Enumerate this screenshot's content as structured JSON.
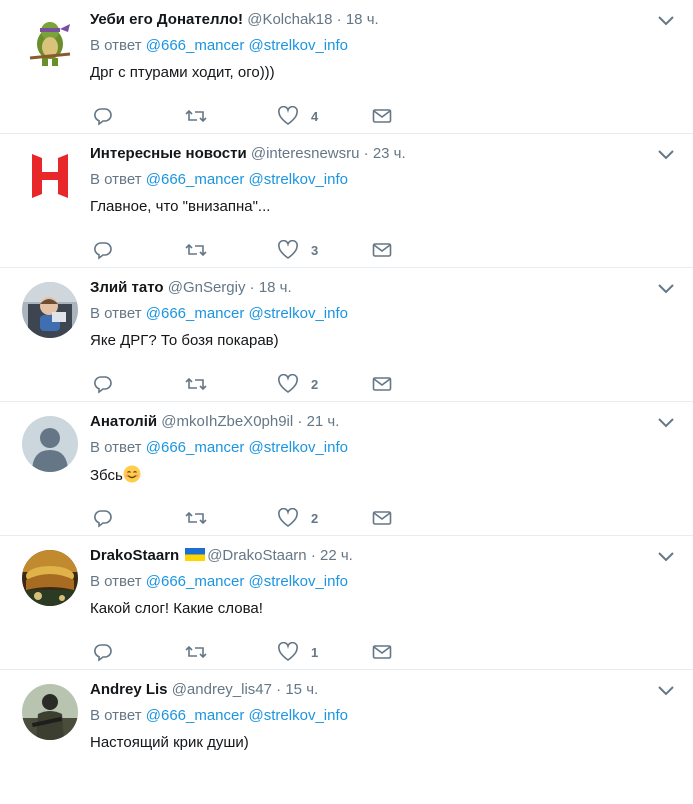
{
  "reply_prefix": "В ответ",
  "tweets": [
    {
      "fullname": "Уеби его Донателло!",
      "username": "@Kolchak18",
      "time": "18 ч.",
      "mentions": "@666_mancer @strelkov_info",
      "text": "Дрг с птурами ходит, ого)))",
      "likes": "4",
      "avatar": "ninja-turtle"
    },
    {
      "fullname": "Интересные новости",
      "username": "@interesnewsru",
      "time": "23 ч.",
      "mentions": "@666_mancer @strelkov_info",
      "text": "Главное, что \"внизапна\"...",
      "likes": "3",
      "avatar": "red-h-logo"
    },
    {
      "fullname": "Злий тато",
      "username": "@GnSergiy",
      "time": "18 ч.",
      "mentions": "@666_mancer @strelkov_info",
      "text": "Яке ДРГ? То бозя покарав)",
      "likes": "2",
      "avatar": "photo-child"
    },
    {
      "fullname": "Анатолій",
      "username": "@mkoIhZbeX0ph9il",
      "time": "21 ч.",
      "mentions": "@666_mancer @strelkov_info",
      "text": "Збсь",
      "likes": "2",
      "avatar": "default-silhouette",
      "emoji": "smiling-face-emoji"
    },
    {
      "fullname": "DrakoStaarn",
      "username": "@DrakoStaarn",
      "time": "22 ч.",
      "mentions": "@666_mancer @strelkov_info",
      "text": "Какой слог! Какие слова!",
      "likes": "1",
      "avatar": "photo-landscape",
      "flag": "ukraine-flag-icon"
    },
    {
      "fullname": "Andrey Lis",
      "username": "@andrey_lis47",
      "time": "15 ч.",
      "mentions": "@666_mancer @strelkov_info",
      "text": "Настоящий крик души)",
      "likes": "",
      "avatar": "photo-soldier"
    }
  ],
  "colors": {
    "accent": "#1b95e0",
    "muted": "#657786",
    "border": "#e6ecf0"
  }
}
